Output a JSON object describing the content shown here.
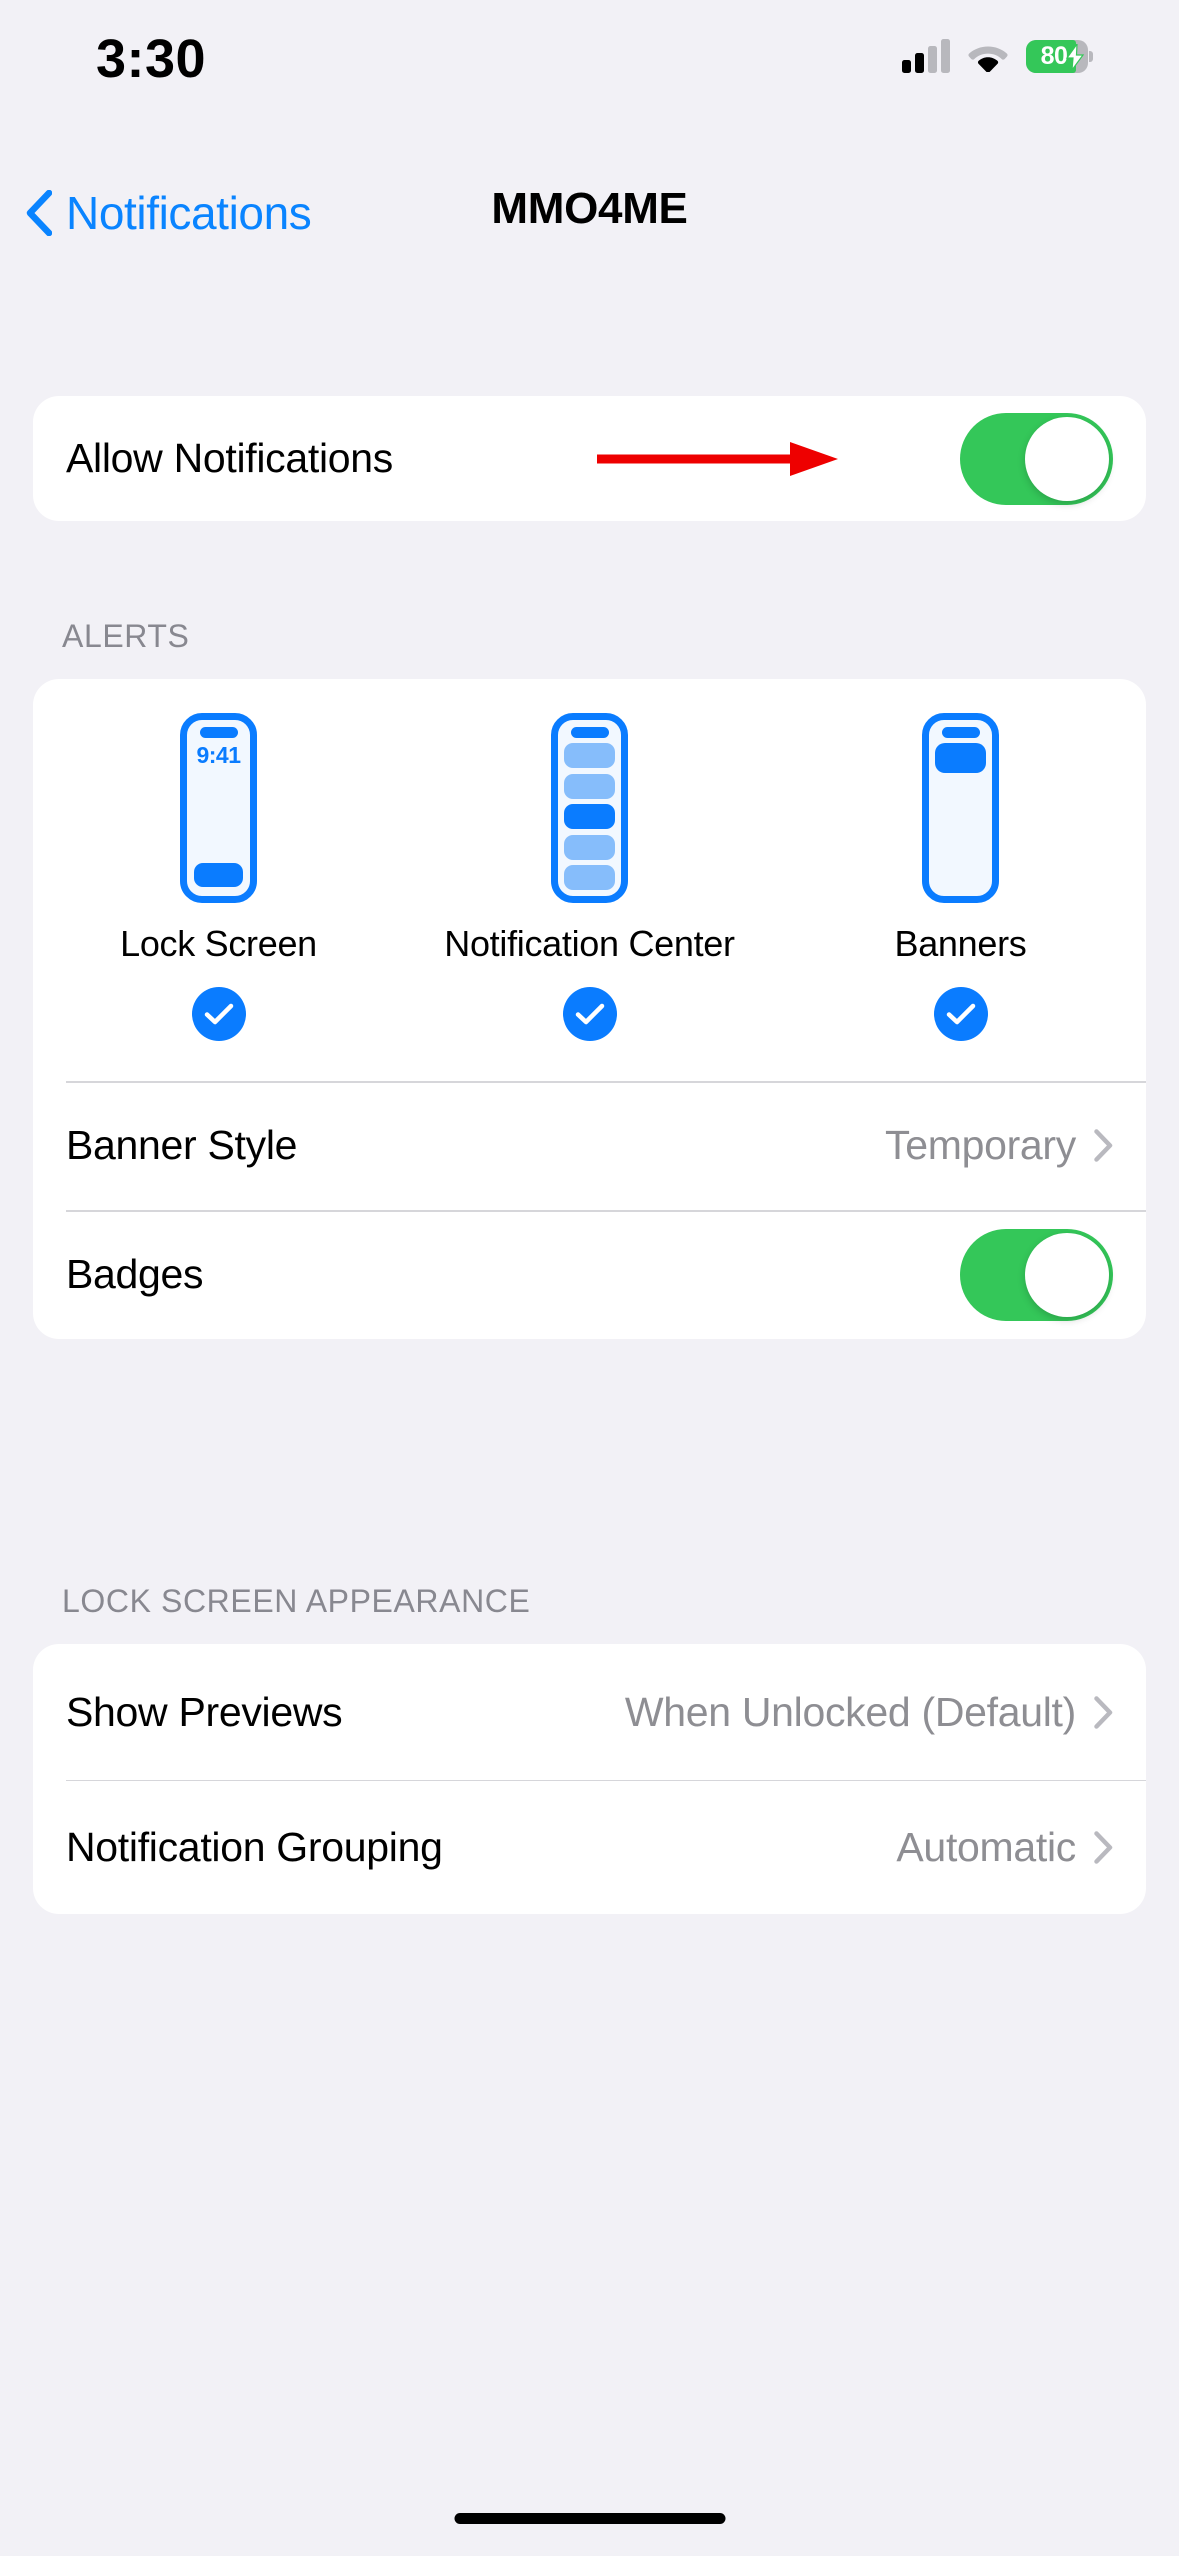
{
  "status_bar": {
    "time": "3:30",
    "cellular_icon": "cellular-signal-icon",
    "cellular_bars_filled": 2,
    "cellular_bars_total": 4,
    "wifi_icon": "wifi-icon",
    "battery_icon": "battery-charging-icon",
    "battery_percent": "80",
    "battery_charging": true,
    "battery_color": "#34c759"
  },
  "nav": {
    "back_label": "Notifications",
    "back_icon": "chevron-left-icon",
    "title": "MMO4ME",
    "accent_color": "#0a84ff"
  },
  "allow_section": {
    "label": "Allow Notifications",
    "toggle_on": true,
    "toggle_color": "#34c759"
  },
  "annotation": {
    "type": "arrow",
    "color": "#ee0000",
    "points_to": "allow-notifications-toggle"
  },
  "alerts_section": {
    "header": "ALERTS",
    "previews": [
      {
        "label": "Lock Screen",
        "type": "lock-screen",
        "time": "9:41",
        "checked": true
      },
      {
        "label": "Notification Center",
        "type": "notification-center",
        "bars": 5,
        "active_bar_index": 2,
        "checked": true
      },
      {
        "label": "Banners",
        "type": "banners",
        "checked": true
      }
    ],
    "rows": [
      {
        "label": "Banner Style",
        "value": "Temporary",
        "accessory": "chevron-right-icon"
      }
    ],
    "badges": {
      "label": "Badges",
      "toggle_on": true,
      "toggle_color": "#34c759"
    }
  },
  "lock_screen_appearance": {
    "header": "LOCK SCREEN APPEARANCE",
    "rows": [
      {
        "label": "Show Previews",
        "value": "When Unlocked (Default)",
        "accessory": "chevron-right-icon"
      },
      {
        "label": "Notification Grouping",
        "value": "Automatic",
        "accessory": "chevron-right-icon"
      }
    ]
  }
}
